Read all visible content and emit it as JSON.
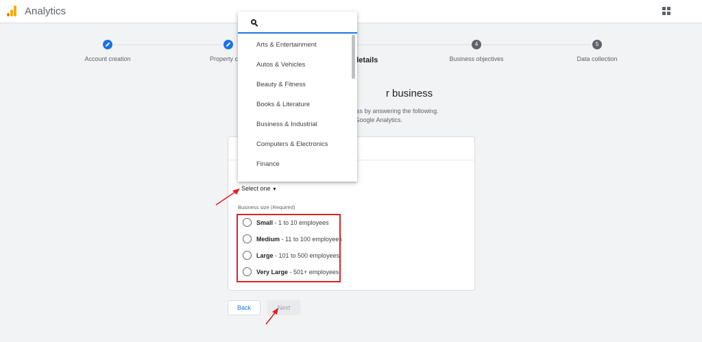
{
  "app": {
    "title": "Analytics"
  },
  "header": {
    "apps_icon": "apps-grid-icon"
  },
  "stepper": {
    "steps": [
      {
        "label": "Account creation",
        "state": "done",
        "icon": "pencil-icon"
      },
      {
        "label": "Property crea",
        "state": "done",
        "icon": "pencil-icon"
      },
      {
        "label": "details",
        "state": "active",
        "number": ""
      },
      {
        "label": "Business objectives",
        "state": "todo",
        "number": "4"
      },
      {
        "label": "Data collection",
        "state": "todo",
        "number": "5"
      }
    ]
  },
  "main": {
    "heading": "r business",
    "sub_line1": "ness by answering the following.",
    "sub_line2": "e Google Analytics."
  },
  "form": {
    "industry_select": "Select one",
    "size_label": "Business size (Required)",
    "sizes": [
      {
        "name": "Small",
        "detail": " - 1 to 10 employees"
      },
      {
        "name": "Medium",
        "detail": " - 11 to 100 employees"
      },
      {
        "name": "Large",
        "detail": " - 101 to 500 employees"
      },
      {
        "name": "Very Large",
        "detail": " - 501+ employees"
      }
    ]
  },
  "buttons": {
    "back": "Back",
    "next": "Next"
  },
  "dropdown": {
    "items": [
      "Arts & Entertainment",
      "Autos & Vehicles",
      "Beauty & Fitness",
      "Books & Literature",
      "Business & Industrial",
      "Computers & Electronics",
      "Finance"
    ]
  },
  "colors": {
    "accent": "#1a73e8",
    "annotation": "#e02020",
    "logo_orange": "#f9ab00"
  }
}
